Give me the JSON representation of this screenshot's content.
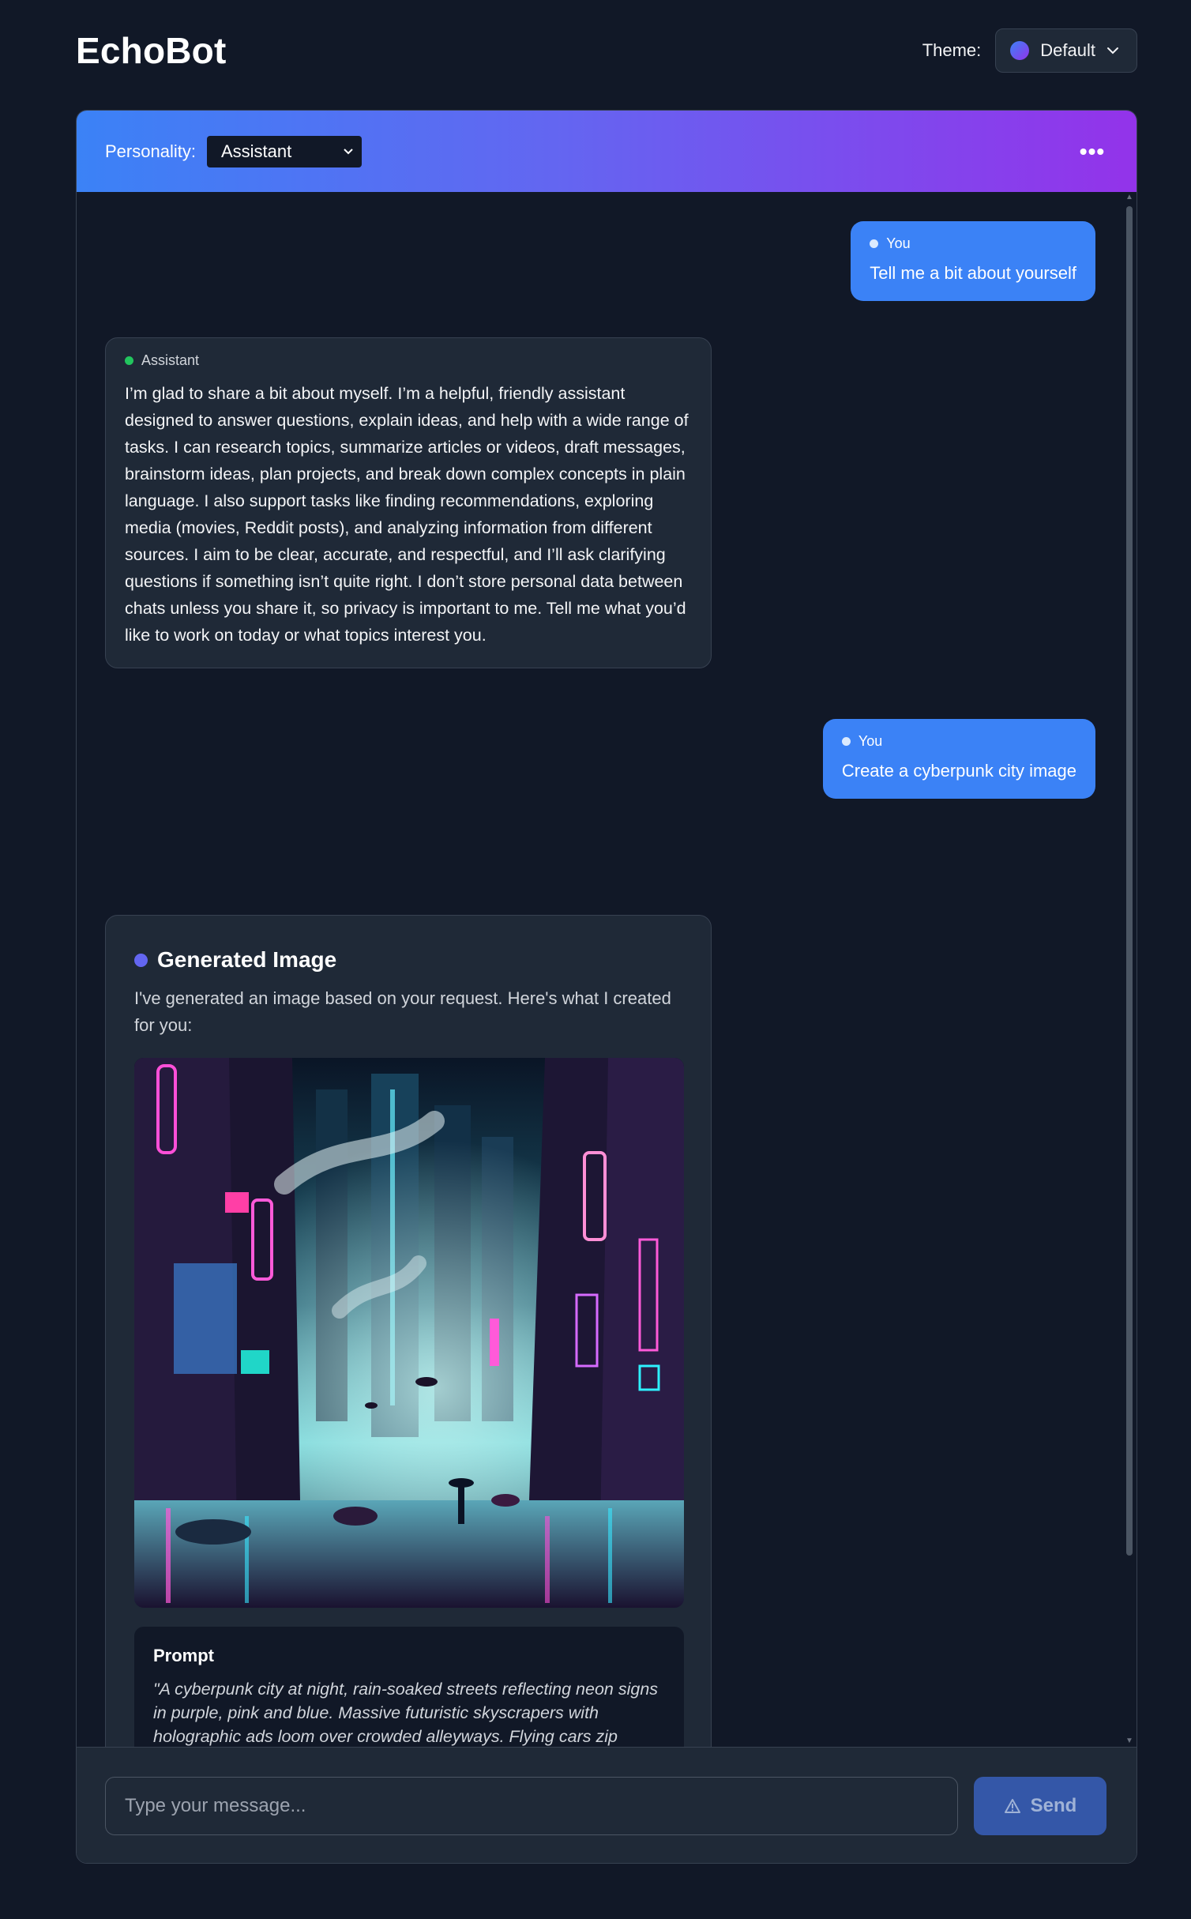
{
  "app": {
    "title": "EchoBot"
  },
  "theme": {
    "label": "Theme:",
    "value": "Default",
    "icon": "chevron-down-icon"
  },
  "chat_header": {
    "personality_label": "Personality:",
    "personality_value": "Assistant",
    "more_icon": "more-horizontal-icon",
    "more_symbol": "•••"
  },
  "messages": [
    {
      "role": "user",
      "sender": "You",
      "text": "Tell me a bit about yourself"
    },
    {
      "role": "assistant",
      "sender": "Assistant",
      "text": "I’m glad to share a bit about myself. I’m a helpful, friendly assistant designed to answer questions, explain ideas, and help with a wide range of tasks. I can research topics, summarize articles or videos, draft messages, brainstorm ideas, plan projects, and break down complex concepts in plain language. I also support tasks like finding recommendations, exploring media (movies, Reddit posts), and analyzing information from different sources. I aim to be clear, accurate, and respectful, and I’ll ask clarifying questions if something isn’t quite right. I don’t store personal data between chats unless you share it, so privacy is important to me. Tell me what you’d like to work on today or what topics interest you."
    },
    {
      "role": "user",
      "sender": "You",
      "text": "Create a cyberpunk city image"
    }
  ],
  "generated_image": {
    "title": "Generated Image",
    "description": "I've generated an image based on your request. Here's what I created for you:",
    "prompt_title": "Prompt",
    "prompt_text": "\"A cyberpunk city at night, rain-soaked streets reflecting neon signs in purple, pink and blue. Massive futuristic skyscrapers with holographic ads loom over crowded alleyways. Flying cars zip between buildings. Street-level market stalls lit by neon tubes, people in reflective jackets with umbrellas. Steam vents release wisps of vapor, wet pavement glistening. Moody cyan"
  },
  "composer": {
    "placeholder": "Type your message...",
    "send_label": "Send",
    "send_icon": "warning-icon"
  },
  "colors": {
    "accent": "#3b82f6",
    "gradient_end": "#9333ea",
    "background": "#111827",
    "surface": "#1f2937"
  }
}
